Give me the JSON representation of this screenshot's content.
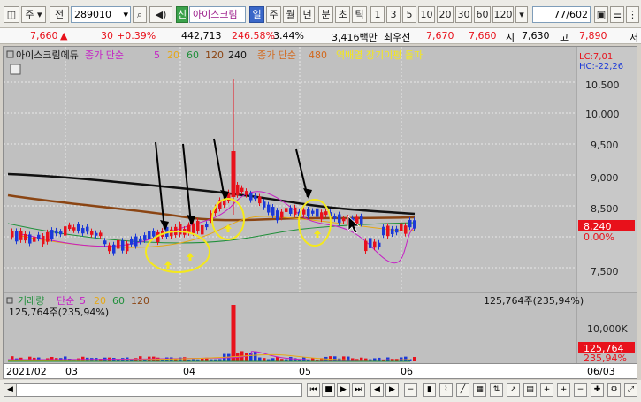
{
  "toolbar": {
    "market": "주",
    "prev": "전",
    "code": "289010",
    "tag": "신",
    "stock_name": "아이스크림",
    "periods": [
      "일",
      "주",
      "월",
      "년",
      "분",
      "초",
      "틱"
    ],
    "period_active": "일",
    "intervals": [
      "1",
      "3",
      "5",
      "10",
      "20",
      "30",
      "60",
      "120"
    ],
    "page_count": "77",
    "page_total": "/602"
  },
  "quote": {
    "price": "7,660",
    "arrow": "▲",
    "change": "30",
    "pct": "+0.39%",
    "volume": "442,713",
    "vol_ratio": "246.58%",
    "turnover": "3.44%",
    "amount": "3,416백만",
    "pri_label": "최우선",
    "ask": "7,670",
    "bid": "7,660",
    "open_label": "시",
    "open": "7,630",
    "high_label": "고",
    "high": "7,890",
    "close_label": "저"
  },
  "legend_top": {
    "name": "아이스크림에듀",
    "ma_label": "종가 단순",
    "ma": [
      "5",
      "20",
      "60",
      "120",
      "240"
    ],
    "ma2_label": "종가 단순",
    "ma2": "480",
    "extra": "역배열 장기이평 돌파"
  },
  "price_axis": {
    "ticks": [
      "10,500",
      "10,000",
      "9,500",
      "9,000",
      "8,500",
      "7,500"
    ],
    "lc": "LC:7,01",
    "hc": "HC:-22,26",
    "last_price": "8,240",
    "last_pct": "0.00%"
  },
  "volume_panel": {
    "label": "거래량",
    "ma_label": "단순",
    "ma": [
      "5",
      "20",
      "60",
      "120"
    ],
    "value_text": "125,764주(235,94%)",
    "right_text": "125,764주(235,94%)",
    "tick": "10,000K",
    "last_vol": "125,764",
    "last_pct": "235,94%"
  },
  "x_axis": {
    "labels": [
      "2021/02",
      "03",
      "04",
      "05",
      "06"
    ],
    "right_label": "06/03"
  },
  "colors": {
    "up": "#e8111b",
    "down": "#1b39d8",
    "ma240": "#111111",
    "ma120": "#8b4513",
    "ma60": "#1f8f3a",
    "ma20": "#e6a817",
    "ma5": "#c51fc5",
    "highlight": "#f4e81c"
  }
}
